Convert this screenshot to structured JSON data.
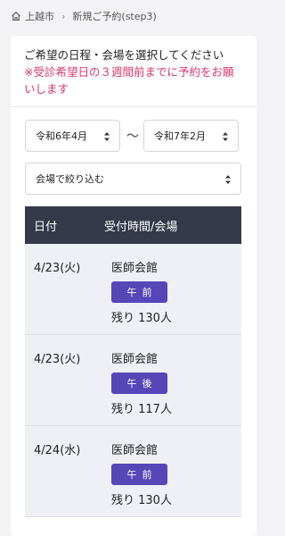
{
  "breadcrumb": {
    "home": "上越市",
    "current": "新規ご予約(step3)"
  },
  "intro": {
    "title": "ご希望の日程・会場を選択してください",
    "notice": "※受診希望日の３週間前までに予約をお願いします"
  },
  "filters": {
    "from": "令和6年4月",
    "separator": "〜",
    "to": "令和7年2月",
    "venue": "会場で絞り込む"
  },
  "table": {
    "headers": [
      "日付",
      "受付時間/会場"
    ],
    "rows": [
      {
        "date": "4/23(火)",
        "venue": "医師会館",
        "slot": "午前",
        "remaining": "残り 130人"
      },
      {
        "date": "4/23(火)",
        "venue": "医師会館",
        "slot": "午後",
        "remaining": "残り 117人"
      },
      {
        "date": "4/24(水)",
        "venue": "医師会館",
        "slot": "午前",
        "remaining": "残り 130人"
      }
    ]
  },
  "colors": {
    "notice": "#d8366b",
    "header_bg": "#353a4a",
    "badge": "#5646b8",
    "row_bg": "#eef0f6"
  }
}
